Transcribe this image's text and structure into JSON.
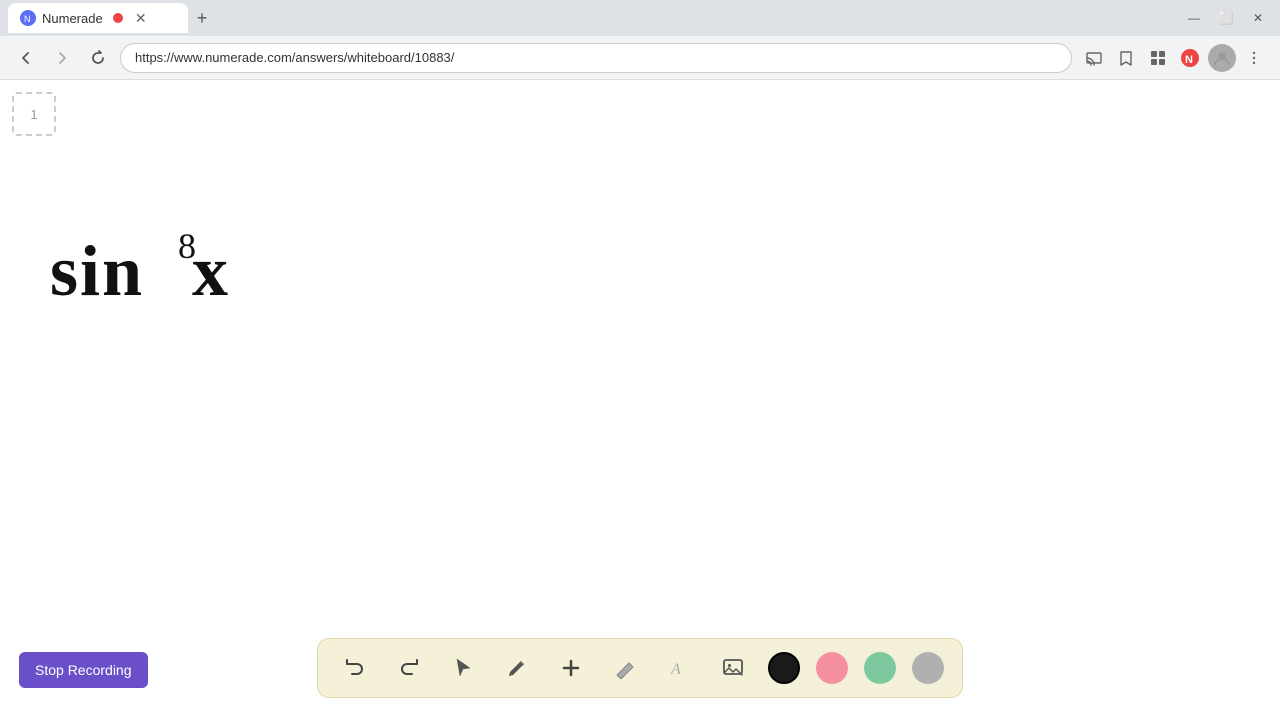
{
  "browser": {
    "tab_title": "Numerade",
    "url": "https://www.numerade.com/answers/whiteboard/10883/",
    "new_tab_label": "+",
    "win_minimize": "—",
    "win_maximize": "⬜",
    "win_close": "✕"
  },
  "nav": {
    "back_icon": "←",
    "forward_icon": "→",
    "refresh_icon": "↻",
    "address": "https://www.numerade.com/answers/whiteboard/10883/"
  },
  "whiteboard": {
    "page_number": "1",
    "math_content": "sin⁸x"
  },
  "toolbar": {
    "undo_icon": "↺",
    "redo_icon": "↻",
    "select_icon": "▷",
    "pen_icon": "✏",
    "add_icon": "+",
    "eraser_icon": "/",
    "text_icon": "A",
    "image_icon": "🖼",
    "colors": [
      {
        "name": "black",
        "hex": "#1a1a1a"
      },
      {
        "name": "pink",
        "hex": "#f48fa0"
      },
      {
        "name": "green",
        "hex": "#7ec8a0"
      },
      {
        "name": "gray",
        "hex": "#b0b0b0"
      }
    ]
  },
  "stop_recording": {
    "label": "Stop Recording"
  }
}
